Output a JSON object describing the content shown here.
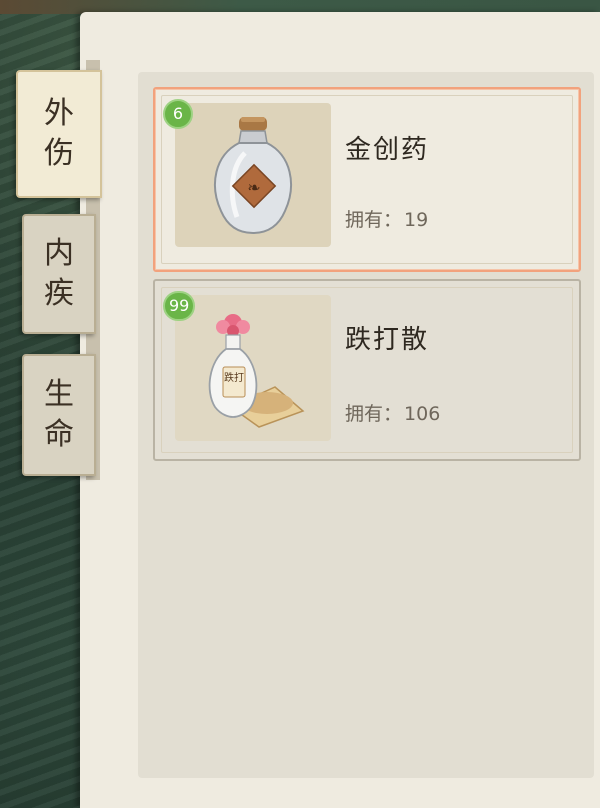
{
  "tabs": [
    {
      "chars": [
        "外",
        "伤"
      ],
      "active": true
    },
    {
      "chars": [
        "内",
        "疾"
      ],
      "active": false
    },
    {
      "chars": [
        "生",
        "命"
      ],
      "active": false
    }
  ],
  "items": [
    {
      "name": "金创药",
      "owned_label": "拥有：",
      "owned_count": "19",
      "badge": "6",
      "icon": "medicine-bottle-icon",
      "selected": true
    },
    {
      "name": "跌打散",
      "owned_label": "拥有：",
      "owned_count": "106",
      "badge": "99",
      "icon": "powder-vase-icon",
      "bottle_label": "跌打",
      "selected": false
    }
  ],
  "colors": {
    "badge_green": "#6ab548",
    "selected_border": "#f2a27d",
    "paper": "#efebe0"
  }
}
